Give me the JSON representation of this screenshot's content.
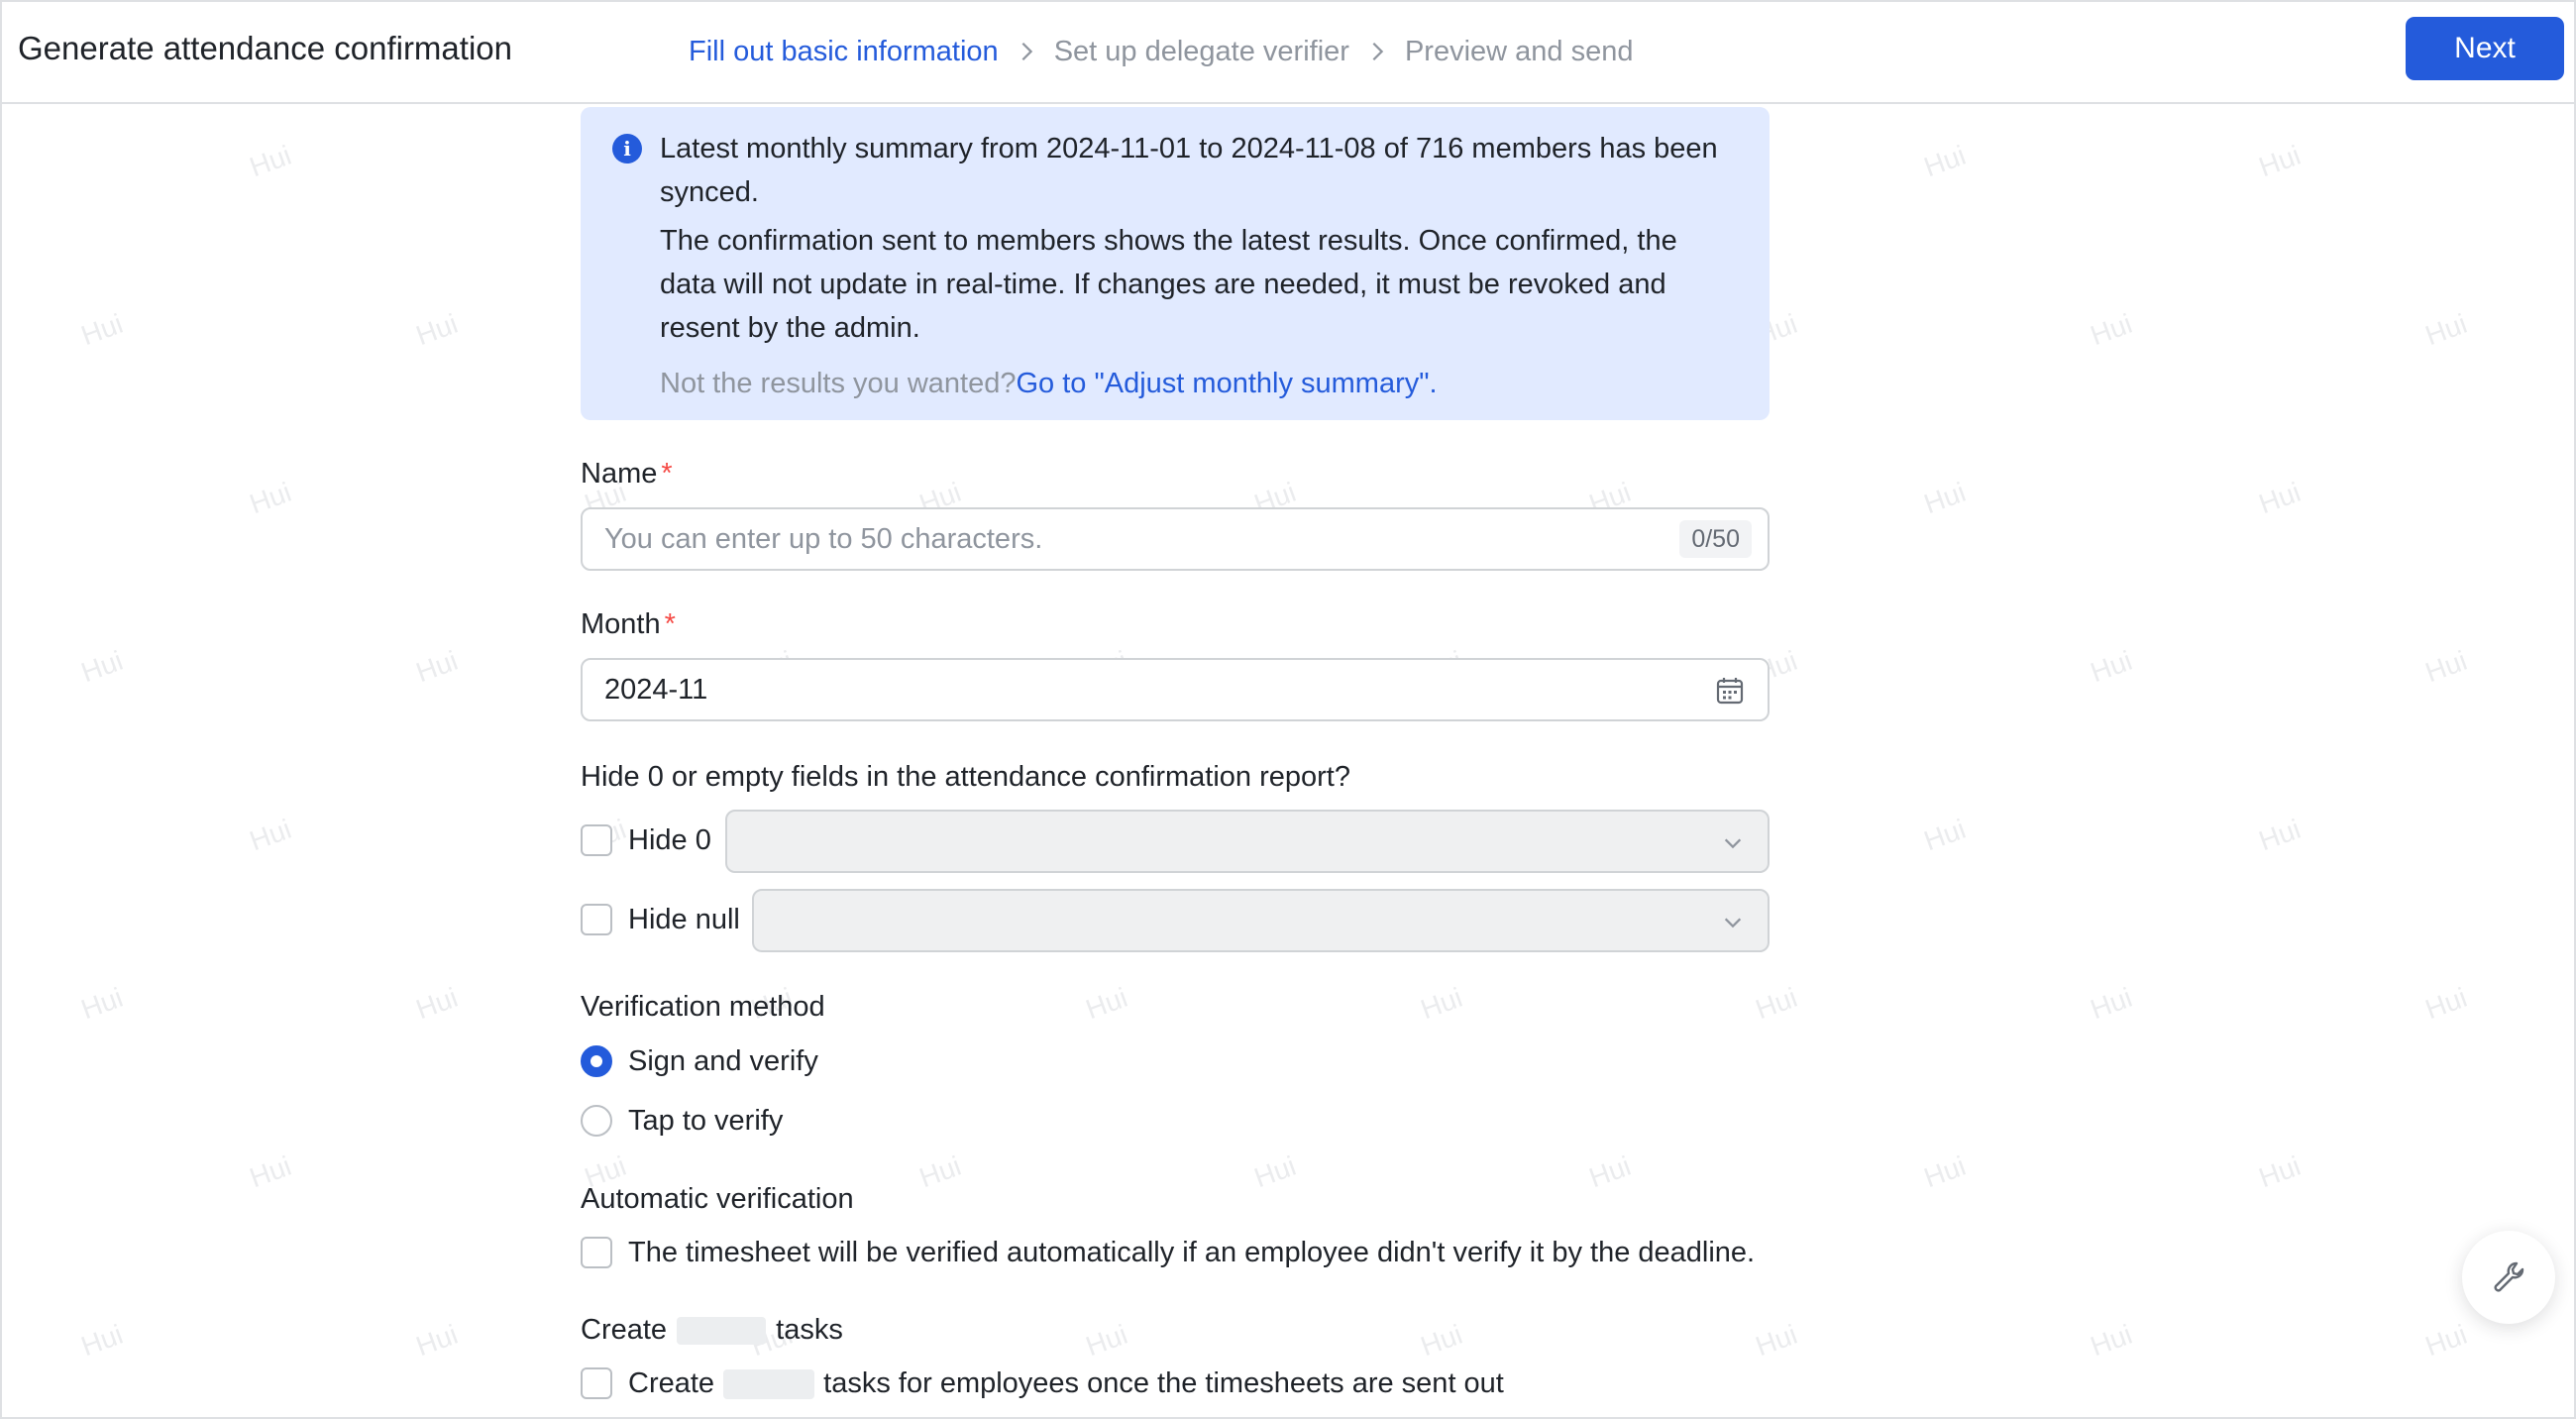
{
  "header": {
    "title": "Generate attendance confirmation",
    "steps": [
      {
        "label": "Fill out basic information",
        "active": true
      },
      {
        "label": "Set up delegate verifier",
        "active": false
      },
      {
        "label": "Preview and send",
        "active": false
      }
    ],
    "next_label": "Next"
  },
  "notice": {
    "icon": "info-icon",
    "headline": "Latest monthly summary from 2024-11-01 to 2024-11-08 of 716 members has been synced.",
    "body": "The confirmation sent to members shows the latest results. Once confirmed, the data will not update in real-time. If changes are needed, it must be revoked and resent by the admin.",
    "foot_text": "Not the results you wanted?",
    "foot_link": "Go to \"Adjust monthly summary\"."
  },
  "form": {
    "name": {
      "label": "Name",
      "required_mark": "*",
      "placeholder": "You can enter up to 50 characters.",
      "value": "",
      "counter": "0/50"
    },
    "month": {
      "label": "Month",
      "required_mark": "*",
      "value": "2024-11",
      "icon": "calendar-icon"
    },
    "hide_fields": {
      "label": "Hide 0 or empty fields in the attendance confirmation report?",
      "options": [
        {
          "label": "Hide 0",
          "checked": false,
          "select_value": ""
        },
        {
          "label": "Hide null",
          "checked": false,
          "select_value": ""
        }
      ]
    },
    "verification_method": {
      "label": "Verification method",
      "options": [
        {
          "label": "Sign and verify",
          "selected": true
        },
        {
          "label": "Tap to verify",
          "selected": false
        }
      ]
    },
    "automatic_verification": {
      "label": "Automatic verification",
      "option_label": "The timesheet will be verified automatically if an employee didn't verify it by the deadline.",
      "checked": false
    },
    "create_tasks": {
      "label_before": "Create",
      "label_after": "tasks",
      "option_before": "Create",
      "option_after": "tasks for employees once the timesheets are sent out",
      "checked": false
    }
  },
  "watermark_text": "Hui",
  "floating_button_icon": "wrench-icon",
  "colors": {
    "accent": "#245bdb",
    "notice_bg": "#e1eaff",
    "required": "#f54a45",
    "muted_text": "#8f959e"
  }
}
